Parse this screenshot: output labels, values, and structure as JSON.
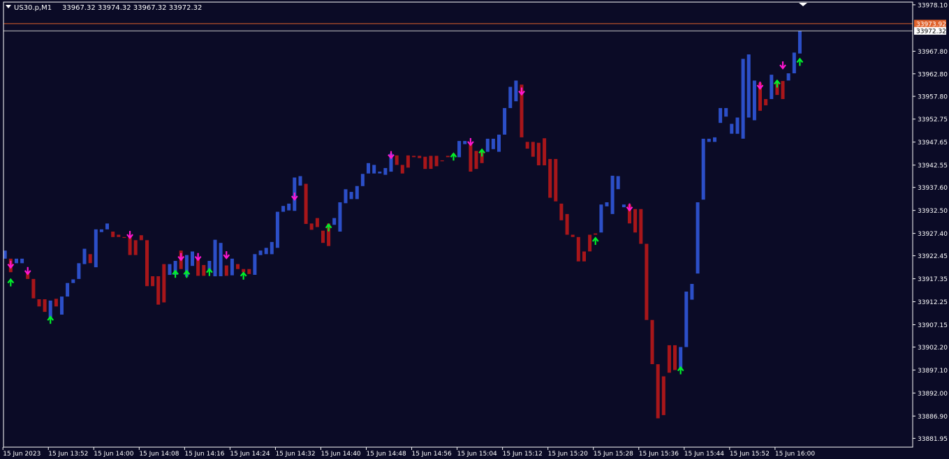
{
  "header": {
    "menu_icon": "triangle-down-icon",
    "symbol": "US30.p,M1",
    "ohlc": "33967.32 33974.32 33967.32 33972.32"
  },
  "colors": {
    "background": "#0b0b26",
    "frame": "#ffffff",
    "bull": "#2c4fc8",
    "bear": "#a8161a",
    "buy_arrow": "#00f02a",
    "sell_arrow": "#ff16d0",
    "ask_line": "#e0622b",
    "bid_line": "#c8c8c8",
    "axis_text": "#ffffff"
  },
  "price_labels": {
    "ask": "33973.92",
    "bid": "33972.32"
  },
  "chart_data": {
    "type": "bar",
    "title": "",
    "symbol": "US30.p",
    "timeframe": "M1",
    "ylim": [
      33880,
      33978.7
    ],
    "grid": false,
    "y_ticks": [
      "33978.10",
      "33973.92",
      "33972.32",
      "33967.80",
      "33962.80",
      "33957.80",
      "33952.75",
      "33947.65",
      "33942.55",
      "33937.60",
      "33932.50",
      "33927.40",
      "33922.45",
      "33917.35",
      "33912.25",
      "33907.15",
      "33902.20",
      "33897.10",
      "33892.00",
      "33886.90",
      "33881.95"
    ],
    "y_tick_values": [
      33978.1,
      33967.8,
      33962.8,
      33957.8,
      33952.75,
      33947.65,
      33942.55,
      33937.6,
      33932.5,
      33927.4,
      33922.45,
      33917.35,
      33912.25,
      33907.15,
      33902.2,
      33897.1,
      33892.0,
      33886.9,
      33881.95
    ],
    "x_ticks": [
      "15 Jun 2023",
      "15 Jun 13:52",
      "15 Jun 14:00",
      "15 Jun 14:08",
      "15 Jun 14:16",
      "15 Jun 14:24",
      "15 Jun 14:32",
      "15 Jun 14:40",
      "15 Jun 14:48",
      "15 Jun 14:56",
      "15 Jun 15:04",
      "15 Jun 15:12",
      "15 Jun 15:20",
      "15 Jun 15:28",
      "15 Jun 15:36",
      "15 Jun 15:44",
      "15 Jun 15:52",
      "15 Jun 16:00"
    ],
    "x_tick_bar_index": [
      0,
      8,
      16,
      24,
      32,
      40,
      48,
      56,
      64,
      72,
      80,
      88,
      96,
      104,
      112,
      120,
      128,
      136
    ],
    "ask": 33973.92,
    "bid": 33972.32,
    "bars": [
      {
        "t": "13:44",
        "bull": true,
        "open": 33921.8,
        "close": 33923.6
      },
      {
        "t": "13:45",
        "bull": false,
        "open": 33921.8,
        "close": 33918.8
      },
      {
        "t": "13:46",
        "bull": true,
        "open": 33920.8,
        "close": 33921.8
      },
      {
        "t": "13:47",
        "bull": true,
        "open": 33920.8,
        "close": 33921.8
      },
      {
        "t": "13:48",
        "bull": false,
        "open": 33918.8,
        "close": 33917.3
      },
      {
        "t": "13:49",
        "bull": false,
        "open": 33917.3,
        "close": 33913.0
      },
      {
        "t": "13:50",
        "bull": false,
        "open": 33912.8,
        "close": 33911.2
      },
      {
        "t": "13:51",
        "bull": false,
        "open": 33912.8,
        "close": 33910.0
      },
      {
        "t": "13:52",
        "bull": true,
        "open": 33908.4,
        "close": 33912.5
      },
      {
        "t": "13:53",
        "bull": false,
        "open": 33912.9,
        "close": 33911.2
      },
      {
        "t": "13:54",
        "bull": true,
        "open": 33909.4,
        "close": 33913.4
      },
      {
        "t": "13:55",
        "bull": true,
        "open": 33913.4,
        "close": 33916.4
      },
      {
        "t": "13:56",
        "bull": true,
        "open": 33916.4,
        "close": 33917.2
      },
      {
        "t": "13:57",
        "bull": true,
        "open": 33917.3,
        "close": 33920.8
      },
      {
        "t": "13:58",
        "bull": true,
        "open": 33920.6,
        "close": 33924.0
      },
      {
        "t": "13:59",
        "bull": false,
        "open": 33922.8,
        "close": 33920.8
      },
      {
        "t": "14:00",
        "bull": true,
        "open": 33919.9,
        "close": 33928.3
      },
      {
        "t": "14:01",
        "bull": true,
        "open": 33927.7,
        "close": 33928.3
      },
      {
        "t": "14:02",
        "bull": true,
        "open": 33928.3,
        "close": 33929.6
      },
      {
        "t": "14:03",
        "bull": false,
        "open": 33927.8,
        "close": 33926.6
      },
      {
        "t": "14:04",
        "bull": false,
        "open": 33927.1,
        "close": 33926.6
      },
      {
        "t": "14:05",
        "bull": false,
        "open": 33926.6,
        "close": 33926.4
      },
      {
        "t": "14:06",
        "bull": false,
        "open": 33926.7,
        "close": 33922.6
      },
      {
        "t": "14:07",
        "bull": false,
        "open": 33925.9,
        "close": 33922.6
      },
      {
        "t": "14:08",
        "bull": false,
        "open": 33927.0,
        "close": 33925.9
      },
      {
        "t": "14:09",
        "bull": false,
        "open": 33925.9,
        "close": 33915.7
      },
      {
        "t": "14:10",
        "bull": false,
        "open": 33917.9,
        "close": 33915.7
      },
      {
        "t": "14:11",
        "bull": false,
        "open": 33917.9,
        "close": 33911.6
      },
      {
        "t": "14:12",
        "bull": false,
        "open": 33920.6,
        "close": 33912.1
      },
      {
        "t": "14:13",
        "bull": true,
        "open": 33918.2,
        "close": 33920.6
      },
      {
        "t": "14:14",
        "bull": true,
        "open": 33918.2,
        "close": 33921.3
      },
      {
        "t": "14:15",
        "bull": false,
        "open": 33923.6,
        "close": 33919.5
      },
      {
        "t": "14:16",
        "bull": true,
        "open": 33917.8,
        "close": 33922.6
      },
      {
        "t": "14:17",
        "bull": true,
        "open": 33920.2,
        "close": 33923.4
      },
      {
        "t": "14:18",
        "bull": false,
        "open": 33921.8,
        "close": 33918.0
      },
      {
        "t": "14:19",
        "bull": false,
        "open": 33920.4,
        "close": 33918.0
      },
      {
        "t": "14:20",
        "bull": true,
        "open": 33919.1,
        "close": 33921.3
      },
      {
        "t": "14:21",
        "bull": true,
        "open": 33917.9,
        "close": 33926.0
      },
      {
        "t": "14:22",
        "bull": true,
        "open": 33917.9,
        "close": 33925.3
      },
      {
        "t": "14:23",
        "bull": false,
        "open": 33920.3,
        "close": 33918.0
      },
      {
        "t": "14:24",
        "bull": true,
        "open": 33918.1,
        "close": 33921.8
      },
      {
        "t": "14:25",
        "bull": false,
        "open": 33920.6,
        "close": 33919.5
      },
      {
        "t": "14:26",
        "bull": false,
        "open": 33919.5,
        "close": 33918.8
      },
      {
        "t": "14:27",
        "bull": false,
        "open": 33919.5,
        "close": 33918.4
      },
      {
        "t": "14:28",
        "bull": true,
        "open": 33918.2,
        "close": 33922.8
      },
      {
        "t": "14:29",
        "bull": true,
        "open": 33922.6,
        "close": 33923.6
      },
      {
        "t": "14:30",
        "bull": true,
        "open": 33922.8,
        "close": 33924.2
      },
      {
        "t": "14:31",
        "bull": true,
        "open": 33922.8,
        "close": 33925.5
      },
      {
        "t": "14:32",
        "bull": true,
        "open": 33924.2,
        "close": 33932.2
      },
      {
        "t": "14:33",
        "bull": true,
        "open": 33932.2,
        "close": 33933.5
      },
      {
        "t": "14:34",
        "bull": true,
        "open": 33932.5,
        "close": 33934.0
      },
      {
        "t": "14:35",
        "bull": true,
        "open": 33932.4,
        "close": 33939.8
      },
      {
        "t": "14:36",
        "bull": true,
        "open": 33938.0,
        "close": 33940.1
      },
      {
        "t": "14:37",
        "bull": false,
        "open": 33938.4,
        "close": 33929.5
      },
      {
        "t": "14:38",
        "bull": false,
        "open": 33929.6,
        "close": 33928.2
      },
      {
        "t": "14:39",
        "bull": false,
        "open": 33930.8,
        "close": 33928.8
      },
      {
        "t": "14:40",
        "bull": false,
        "open": 33928.0,
        "close": 33925.3
      },
      {
        "t": "14:41",
        "bull": false,
        "open": 33929.6,
        "close": 33924.6
      },
      {
        "t": "14:42",
        "bull": true,
        "open": 33929.3,
        "close": 33930.8
      },
      {
        "t": "14:43",
        "bull": true,
        "open": 33927.8,
        "close": 33934.3
      },
      {
        "t": "14:44",
        "bull": true,
        "open": 33934.1,
        "close": 33937.2
      },
      {
        "t": "14:45",
        "bull": true,
        "open": 33935.0,
        "close": 33936.6
      },
      {
        "t": "14:46",
        "bull": true,
        "open": 33935.0,
        "close": 33937.9
      },
      {
        "t": "14:47",
        "bull": true,
        "open": 33937.9,
        "close": 33940.6
      },
      {
        "t": "14:48",
        "bull": true,
        "open": 33940.7,
        "close": 33943.0
      },
      {
        "t": "14:49",
        "bull": true,
        "open": 33940.7,
        "close": 33942.6
      },
      {
        "t": "14:50",
        "bull": true,
        "open": 33940.7,
        "close": 33941.1
      },
      {
        "t": "14:51",
        "bull": true,
        "open": 33940.4,
        "close": 33941.9
      },
      {
        "t": "14:52",
        "bull": true,
        "open": 33941.1,
        "close": 33945.1
      },
      {
        "t": "14:53",
        "bull": false,
        "open": 33944.7,
        "close": 33942.6
      },
      {
        "t": "14:54",
        "bull": false,
        "open": 33942.6,
        "close": 33940.7
      },
      {
        "t": "14:55",
        "bull": false,
        "open": 33944.7,
        "close": 33942.0
      },
      {
        "t": "14:56",
        "bull": false,
        "open": 33944.6,
        "close": 33944.3
      },
      {
        "t": "14:57",
        "bull": false,
        "open": 33944.6,
        "close": 33944.1
      },
      {
        "t": "14:58",
        "bull": false,
        "open": 33944.4,
        "close": 33941.7
      },
      {
        "t": "14:59",
        "bull": false,
        "open": 33944.6,
        "close": 33941.7
      },
      {
        "t": "15:00",
        "bull": false,
        "open": 33944.6,
        "close": 33942.3
      },
      {
        "t": "15:01",
        "bull": false,
        "open": 33943.6,
        "close": 33943.4
      },
      {
        "t": "15:02",
        "bull": false,
        "open": 33944.6,
        "close": 33944.3
      },
      {
        "t": "15:03",
        "bull": false,
        "open": 33945.1,
        "close": 33944.6
      },
      {
        "t": "15:04",
        "bull": true,
        "open": 33944.3,
        "close": 33947.9
      },
      {
        "t": "15:05",
        "bull": true,
        "open": 33947.2,
        "close": 33947.9
      },
      {
        "t": "15:06",
        "bull": false,
        "open": 33947.2,
        "close": 33941.1
      },
      {
        "t": "15:07",
        "bull": false,
        "open": 33945.7,
        "close": 33941.7
      },
      {
        "t": "15:08",
        "bull": false,
        "open": 33945.7,
        "close": 33943.0
      },
      {
        "t": "15:09",
        "bull": true,
        "open": 33945.5,
        "close": 33948.4
      },
      {
        "t": "15:10",
        "bull": true,
        "open": 33946.1,
        "close": 33948.4
      },
      {
        "t": "15:11",
        "bull": true,
        "open": 33945.5,
        "close": 33949.3
      },
      {
        "t": "15:12",
        "bull": true,
        "open": 33949.3,
        "close": 33955.2
      },
      {
        "t": "15:13",
        "bull": true,
        "open": 33955.2,
        "close": 33959.9
      },
      {
        "t": "15:14",
        "bull": true,
        "open": 33956.7,
        "close": 33961.3
      },
      {
        "t": "15:15",
        "bull": false,
        "open": 33960.4,
        "close": 33948.7
      },
      {
        "t": "15:16",
        "bull": false,
        "open": 33947.7,
        "close": 33946.2
      },
      {
        "t": "15:17",
        "bull": false,
        "open": 33947.7,
        "close": 33944.4
      },
      {
        "t": "15:18",
        "bull": false,
        "open": 33947.5,
        "close": 33942.5
      },
      {
        "t": "15:19",
        "bull": false,
        "open": 33948.5,
        "close": 33942.5
      },
      {
        "t": "15:20",
        "bull": false,
        "open": 33943.9,
        "close": 33935.3
      },
      {
        "t": "15:21",
        "bull": false,
        "open": 33943.9,
        "close": 33934.5
      },
      {
        "t": "15:22",
        "bull": false,
        "open": 33934.0,
        "close": 33930.3
      },
      {
        "t": "15:23",
        "bull": false,
        "open": 33931.7,
        "close": 33927.1
      },
      {
        "t": "15:24",
        "bull": false,
        "open": 33927.1,
        "close": 33926.6
      },
      {
        "t": "15:25",
        "bull": false,
        "open": 33926.6,
        "close": 33921.2
      },
      {
        "t": "15:26",
        "bull": false,
        "open": 33923.4,
        "close": 33921.2
      },
      {
        "t": "15:27",
        "bull": false,
        "open": 33927.1,
        "close": 33923.4
      },
      {
        "t": "15:28",
        "bull": false,
        "open": 33927.4,
        "close": 33927.1
      },
      {
        "t": "15:29",
        "bull": true,
        "open": 33927.6,
        "close": 33933.8
      },
      {
        "t": "15:30",
        "bull": true,
        "open": 33933.4,
        "close": 33934.3
      },
      {
        "t": "15:31",
        "bull": true,
        "open": 33931.7,
        "close": 33940.2
      },
      {
        "t": "15:32",
        "bull": true,
        "open": 33937.2,
        "close": 33940.1
      },
      {
        "t": "15:33",
        "bull": true,
        "open": 33933.2,
        "close": 33933.8
      },
      {
        "t": "15:34",
        "bull": false,
        "open": 33933.8,
        "close": 33929.6
      },
      {
        "t": "15:35",
        "bull": false,
        "open": 33932.8,
        "close": 33927.6
      },
      {
        "t": "15:36",
        "bull": false,
        "open": 33932.8,
        "close": 33925.1
      },
      {
        "t": "15:37",
        "bull": false,
        "open": 33925.1,
        "close": 33908.2
      },
      {
        "t": "15:38",
        "bull": false,
        "open": 33908.2,
        "close": 33898.4
      },
      {
        "t": "15:39",
        "bull": false,
        "open": 33898.4,
        "close": 33886.4
      },
      {
        "t": "15:40",
        "bull": false,
        "open": 33895.7,
        "close": 33887.1
      },
      {
        "t": "15:41",
        "bull": false,
        "open": 33902.6,
        "close": 33896.5
      },
      {
        "t": "15:42",
        "bull": false,
        "open": 33902.6,
        "close": 33897.1
      },
      {
        "t": "15:43",
        "bull": true,
        "open": 33897.1,
        "close": 33902.2
      },
      {
        "t": "15:44",
        "bull": true,
        "open": 33902.2,
        "close": 33914.5
      },
      {
        "t": "15:45",
        "bull": true,
        "open": 33912.7,
        "close": 33916.2
      },
      {
        "t": "15:46",
        "bull": true,
        "open": 33918.5,
        "close": 33934.3
      },
      {
        "t": "15:47",
        "bull": true,
        "open": 33934.9,
        "close": 33948.4
      },
      {
        "t": "15:48",
        "bull": true,
        "open": 33947.7,
        "close": 33948.4
      },
      {
        "t": "15:49",
        "bull": true,
        "open": 33947.7,
        "close": 33948.7
      },
      {
        "t": "15:50",
        "bull": true,
        "open": 33951.9,
        "close": 33955.2
      },
      {
        "t": "15:51",
        "bull": true,
        "open": 33953.3,
        "close": 33955.2
      },
      {
        "t": "15:52",
        "bull": true,
        "open": 33949.5,
        "close": 33951.7
      },
      {
        "t": "15:53",
        "bull": true,
        "open": 33949.5,
        "close": 33953.1
      },
      {
        "t": "15:54",
        "bull": true,
        "open": 33948.4,
        "close": 33966.1
      },
      {
        "t": "15:55",
        "bull": true,
        "open": 33953.1,
        "close": 33967.1
      },
      {
        "t": "15:56",
        "bull": true,
        "open": 33952.5,
        "close": 33961.3
      },
      {
        "t": "15:57",
        "bull": false,
        "open": 33960.8,
        "close": 33954.6
      },
      {
        "t": "15:58",
        "bull": false,
        "open": 33957.2,
        "close": 33955.8
      },
      {
        "t": "15:59",
        "bull": true,
        "open": 33957.2,
        "close": 33962.6
      },
      {
        "t": "16:00",
        "bull": false,
        "open": 33961.2,
        "close": 33958.1
      },
      {
        "t": "16:01",
        "bull": false,
        "open": 33961.2,
        "close": 33957.2
      },
      {
        "t": "16:02",
        "bull": true,
        "open": 33961.3,
        "close": 33962.9
      },
      {
        "t": "16:03",
        "bull": true,
        "open": 33962.9,
        "close": 33967.5
      },
      {
        "t": "16:04",
        "bull": true,
        "open": 33967.3,
        "close": 33972.3
      }
    ],
    "signals": [
      {
        "bar": 1,
        "dir": "up",
        "price": 33917.2
      },
      {
        "bar": 1,
        "dir": "down",
        "price": 33919.8
      },
      {
        "bar": 4,
        "dir": "down",
        "price": 33918.4
      },
      {
        "bar": 8,
        "dir": "up",
        "price": 33908.9
      },
      {
        "bar": 22,
        "dir": "down",
        "price": 33926.4
      },
      {
        "bar": 30,
        "dir": "up",
        "price": 33919.1
      },
      {
        "bar": 31,
        "dir": "down",
        "price": 33921.5
      },
      {
        "bar": 32,
        "dir": "up",
        "price": 33919.1
      },
      {
        "bar": 34,
        "dir": "down",
        "price": 33921.5
      },
      {
        "bar": 36,
        "dir": "up",
        "price": 33919.5
      },
      {
        "bar": 39,
        "dir": "down",
        "price": 33921.9
      },
      {
        "bar": 42,
        "dir": "up",
        "price": 33918.7
      },
      {
        "bar": 51,
        "dir": "down",
        "price": 33934.9
      },
      {
        "bar": 57,
        "dir": "up",
        "price": 33929.4
      },
      {
        "bar": 68,
        "dir": "down",
        "price": 33944.1
      },
      {
        "bar": 79,
        "dir": "up",
        "price": 33945.1
      },
      {
        "bar": 82,
        "dir": "down",
        "price": 33947.0
      },
      {
        "bar": 84,
        "dir": "up",
        "price": 33946.0
      },
      {
        "bar": 91,
        "dir": "down",
        "price": 33958.2
      },
      {
        "bar": 104,
        "dir": "up",
        "price": 33926.4
      },
      {
        "bar": 110,
        "dir": "down",
        "price": 33932.5
      },
      {
        "bar": 119,
        "dir": "up",
        "price": 33897.7
      },
      {
        "bar": 133,
        "dir": "down",
        "price": 33959.5
      },
      {
        "bar": 136,
        "dir": "up",
        "price": 33961.3
      },
      {
        "bar": 137,
        "dir": "down",
        "price": 33964.0
      },
      {
        "bar": 140,
        "dir": "up",
        "price": 33966.1
      }
    ]
  }
}
